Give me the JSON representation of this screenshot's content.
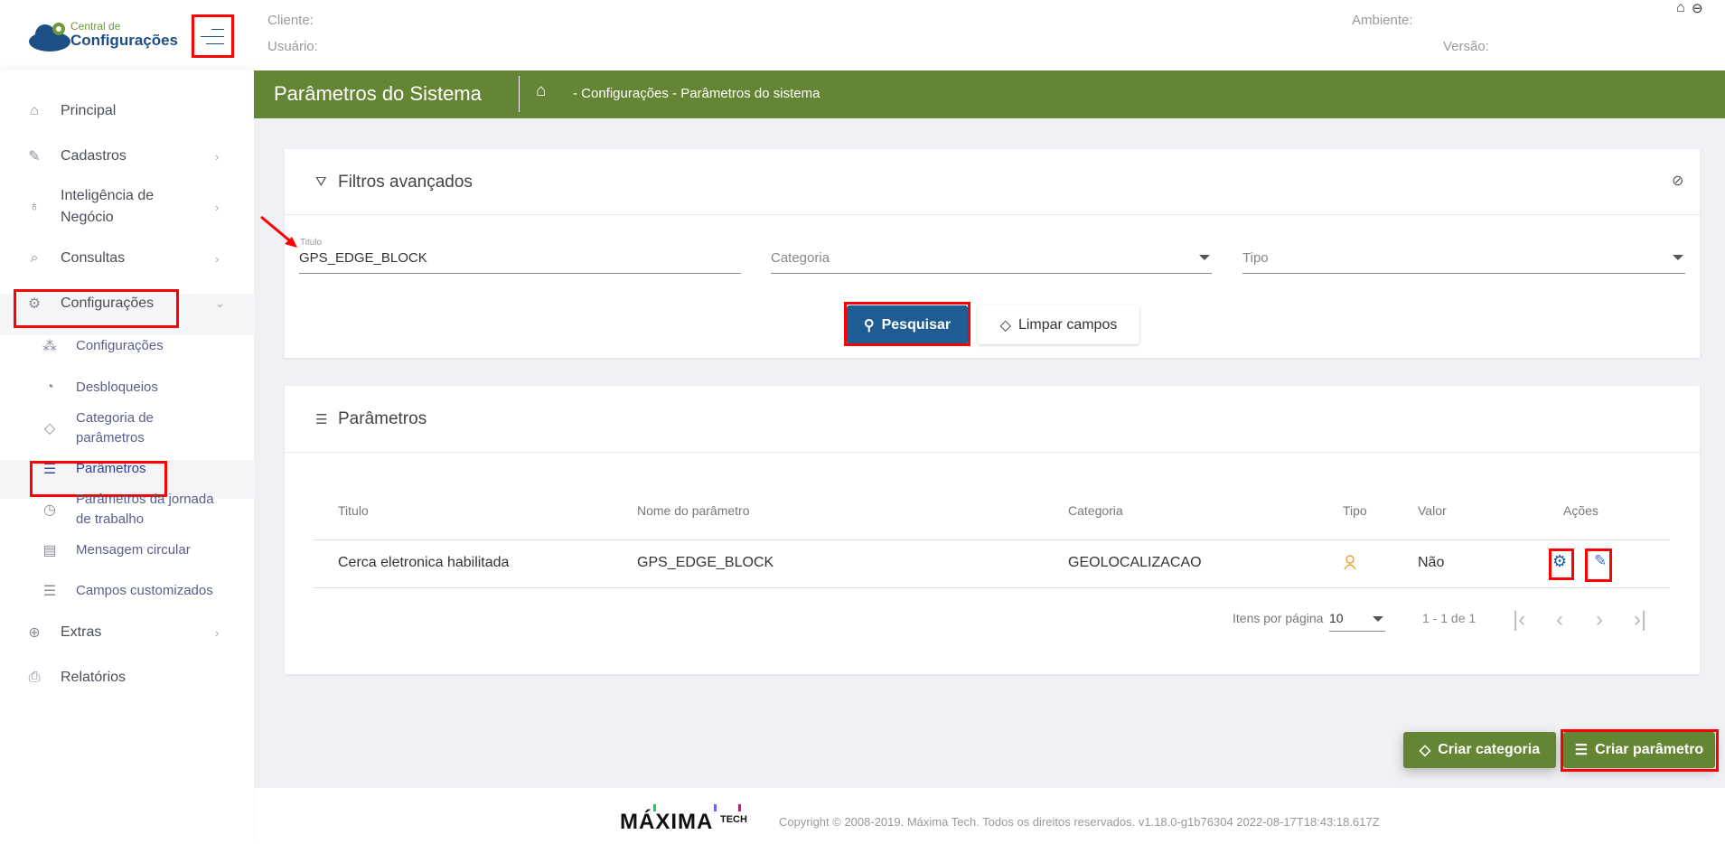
{
  "logo": {
    "small": "Central de",
    "big": "Configurações"
  },
  "header": {
    "cliente": "Cliente:",
    "usuario": "Usuário:",
    "ambiente": "Ambiente:",
    "versao": "Versão:"
  },
  "pagebar": {
    "title": "Parâmetros do Sistema",
    "breadcrumb": "- Configurações - Parâmetros do sistema"
  },
  "sidebar": {
    "items": [
      {
        "label": "Principal",
        "icon": "home-icon"
      },
      {
        "label": "Cadastros",
        "icon": "edit-icon"
      },
      {
        "label": "Inteligência de Negócio",
        "icon": "lightbulb-icon"
      },
      {
        "label": "Consultas",
        "icon": "search-icon"
      },
      {
        "label": "Configurações",
        "icon": "gear-icon"
      },
      {
        "label": "Extras",
        "icon": "plus-circle-icon"
      },
      {
        "label": "Relatórios",
        "icon": "printer-icon"
      }
    ],
    "sub": [
      {
        "label": "Configurações",
        "icon": "nodes-icon"
      },
      {
        "label": "Desbloqueios",
        "icon": "unlock-icon"
      },
      {
        "label": "Categoria de parâmetros",
        "icon": "tag-icon"
      },
      {
        "label": "Parâmetros",
        "icon": "list-icon"
      },
      {
        "label": "Parâmetros da jornada de trabalho",
        "icon": "clock-icon"
      },
      {
        "label": "Mensagem circular",
        "icon": "message-icon"
      },
      {
        "label": "Campos customizados",
        "icon": "fields-icon"
      }
    ]
  },
  "filters": {
    "title": "Filtros avançados",
    "titulo_label": "Titulo",
    "titulo_value": "GPS_EDGE_BLOCK",
    "categoria_placeholder": "Categoria",
    "tipo_placeholder": "Tipo",
    "search": "Pesquisar",
    "clear": "Limpar campos"
  },
  "params": {
    "title": "Parâmetros",
    "columns": [
      "Titulo",
      "Nome do parâmetro",
      "Categoria",
      "Tipo",
      "Valor",
      "Ações"
    ],
    "rows": [
      {
        "titulo": "Cerca eletronica habilitada",
        "nome": "GPS_EDGE_BLOCK",
        "categoria": "GEOLOCALIZACAO",
        "tipo": "user-icon",
        "valor": "Não"
      }
    ],
    "per_page_label": "Itens por página",
    "per_page": "10",
    "range": "1 - 1 de 1"
  },
  "actions": {
    "create_category": "Criar categoria",
    "create_param": "Criar parâmetro"
  },
  "footer": {
    "logo": "MÁXIMA TECH",
    "copyright": "Copyright © 2008-2019. Máxima Tech. Todos os direitos reservados. v1.18.0-g1b76304 2022-08-17T18:43:18.617Z"
  },
  "colors": {
    "green": "#648534",
    "blue": "#1e5c94",
    "bg": "#f0f1f5",
    "orange": "#f0a030"
  }
}
